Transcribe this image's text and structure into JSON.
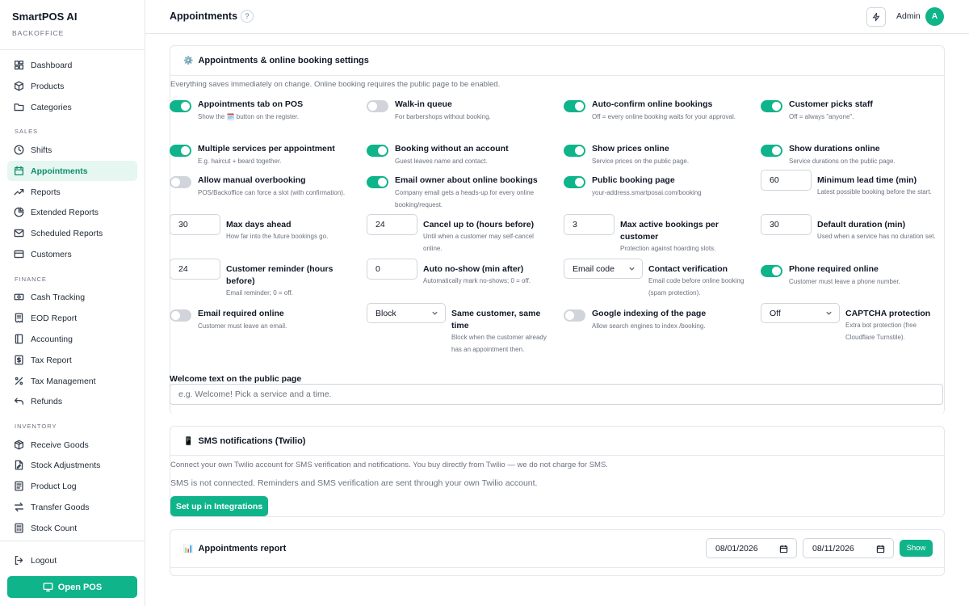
{
  "app": {
    "name": "SmartPOS AI",
    "subtitle": "BACKOFFICE"
  },
  "sidebar": {
    "items": [
      {
        "label": "Dashboard",
        "icon": "dashboard-icon"
      },
      {
        "label": "Products",
        "icon": "box-icon"
      },
      {
        "label": "Categories",
        "icon": "folder-icon"
      },
      {
        "label": "Shifts",
        "icon": "clock-icon"
      },
      {
        "label": "Appointments",
        "icon": "calendar-icon",
        "active": true
      },
      {
        "label": "Reports",
        "icon": "trend-icon"
      },
      {
        "label": "Extended Reports",
        "icon": "pie-icon"
      },
      {
        "label": "Scheduled Reports",
        "icon": "mail-icon"
      },
      {
        "label": "Customers",
        "icon": "card-icon"
      },
      {
        "label": "Cash Tracking",
        "icon": "cash-icon"
      },
      {
        "label": "EOD Report",
        "icon": "receipt-icon"
      },
      {
        "label": "Accounting",
        "icon": "ledger-icon"
      },
      {
        "label": "Tax Report",
        "icon": "tax-report-icon"
      },
      {
        "label": "Tax Management",
        "icon": "percent-icon"
      },
      {
        "label": "Refunds",
        "icon": "undo-icon"
      },
      {
        "label": "Receive Goods",
        "icon": "package-icon"
      },
      {
        "label": "Stock Adjustments",
        "icon": "file-edit-icon"
      },
      {
        "label": "Product Log",
        "icon": "log-icon"
      },
      {
        "label": "Transfer Goods",
        "icon": "transfer-icon"
      },
      {
        "label": "Stock Count",
        "icon": "count-icon"
      }
    ],
    "sections": {
      "sales": "SALES",
      "finance": "FINANCE",
      "inventory": "INVENTORY"
    },
    "logout": "Logout",
    "open_pos": "Open POS"
  },
  "header": {
    "title": "Appointments",
    "help": "?",
    "user": "Admin",
    "avatar_letter": "A"
  },
  "booking": {
    "title": "Appointments & online booking settings",
    "note": "Everything saves immediately on change. Online booking requires the public page to be enabled.",
    "settings": [
      {
        "kind": "toggle",
        "on": true,
        "title": "Appointments tab on POS",
        "desc": "Show the 🗓️ button on the register."
      },
      {
        "kind": "toggle",
        "on": false,
        "title": "Walk-in queue",
        "desc": "For barbershops without booking."
      },
      {
        "kind": "toggle",
        "on": true,
        "title": "Auto-confirm online bookings",
        "desc": "Off = every online booking waits for your approval."
      },
      {
        "kind": "toggle",
        "on": true,
        "title": "Customer picks staff",
        "desc": "Off = always \"anyone\"."
      },
      {
        "kind": "toggle",
        "on": true,
        "title": "Multiple services per appointment",
        "desc": "E.g. haircut + beard together."
      },
      {
        "kind": "toggle",
        "on": true,
        "title": "Booking without an account",
        "desc": "Guest leaves name and contact."
      },
      {
        "kind": "toggle",
        "on": true,
        "title": "Show prices online",
        "desc": "Service prices on the public page."
      },
      {
        "kind": "toggle",
        "on": true,
        "title": "Show durations online",
        "desc": "Service durations on the public page."
      },
      {
        "kind": "toggle",
        "on": false,
        "title": "Allow manual overbooking",
        "desc": "POS/Backoffice can force a slot (with confirmation)."
      },
      {
        "kind": "toggle",
        "on": true,
        "title": "Email owner about online bookings",
        "desc": "Company email gets a heads-up for every online booking/request."
      },
      {
        "kind": "toggle",
        "on": true,
        "title": "Public booking page",
        "desc": "your-address.smartposai.com/booking"
      },
      {
        "kind": "number",
        "value": "60",
        "title": "Minimum lead time (min)",
        "desc": "Latest possible booking before the start."
      },
      {
        "kind": "number",
        "value": "30",
        "title": "Max days ahead",
        "desc": "How far into the future bookings go."
      },
      {
        "kind": "number",
        "value": "24",
        "title": "Cancel up to (hours before)",
        "desc": "Until when a customer may self-cancel online."
      },
      {
        "kind": "number",
        "value": "3",
        "title": "Max active bookings per customer",
        "desc": "Protection against hoarding slots."
      },
      {
        "kind": "number",
        "value": "30",
        "title": "Default duration (min)",
        "desc": "Used when a service has no duration set."
      },
      {
        "kind": "number",
        "value": "24",
        "title": "Customer reminder (hours before)",
        "desc": "Email reminder; 0 = off."
      },
      {
        "kind": "number",
        "value": "0",
        "title": "Auto no-show (min after)",
        "desc": "Automatically mark no-shows; 0 = off."
      },
      {
        "kind": "select",
        "value": "Email code",
        "title": "Contact verification",
        "desc": "Email code before online booking (spam protection)."
      },
      {
        "kind": "toggle",
        "on": true,
        "title": "Phone required online",
        "desc": "Customer must leave a phone number."
      },
      {
        "kind": "toggle",
        "on": false,
        "title": "Email required online",
        "desc": "Customer must leave an email."
      },
      {
        "kind": "select",
        "value": "Block",
        "title": "Same customer, same time",
        "desc": "Block when the customer already has an appointment then."
      },
      {
        "kind": "toggle",
        "on": false,
        "title": "Google indexing of the page",
        "desc": "Allow search engines to index /booking."
      },
      {
        "kind": "select",
        "value": "Off",
        "title": "CAPTCHA protection",
        "desc": "Extra bot protection (free Cloudflare Turnstile)."
      }
    ],
    "welcome_label": "Welcome text on the public page",
    "welcome_placeholder": "e.g. Welcome! Pick a service and a time."
  },
  "sms": {
    "title": "SMS notifications (Twilio)",
    "note": "Connect your own Twilio account for SMS verification and notifications. You buy directly from Twilio — we do not charge for SMS.",
    "status": "SMS is not connected. Reminders and SMS verification are sent through your own Twilio account.",
    "button": "Set up in Integrations"
  },
  "report": {
    "title": "Appointments report",
    "date_from": "08/01/2026",
    "date_to": "08/11/2026",
    "button": "Show"
  },
  "colors": {
    "accent": "#0fb48a",
    "active_bg": "#e6f6f1",
    "toggle_off": "#d1d5db"
  }
}
